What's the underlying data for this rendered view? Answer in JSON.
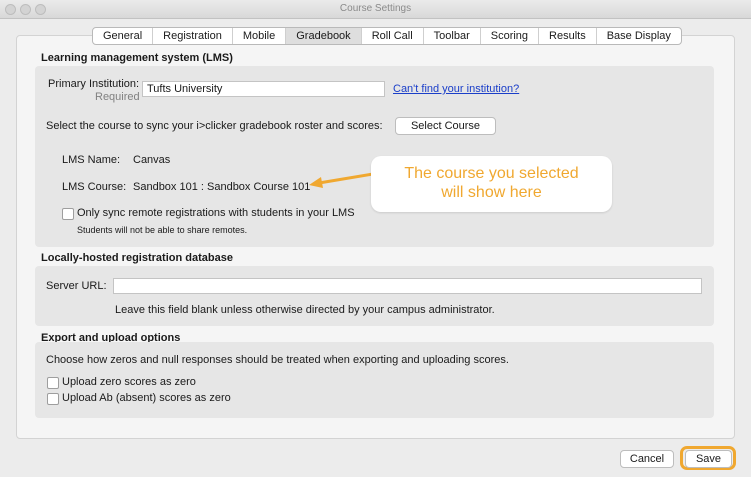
{
  "window": {
    "title": "Course Settings"
  },
  "tabs": [
    {
      "label": "General"
    },
    {
      "label": "Registration"
    },
    {
      "label": "Mobile"
    },
    {
      "label": "Gradebook",
      "active": true
    },
    {
      "label": "Roll Call"
    },
    {
      "label": "Toolbar"
    },
    {
      "label": "Scoring"
    },
    {
      "label": "Results"
    },
    {
      "label": "Base Display"
    }
  ],
  "lms": {
    "section_title": "Learning management system (LMS)",
    "institution_label": "Primary Institution:",
    "institution_required": "Required",
    "institution_value": "Tufts University",
    "cant_find_link": "Can't find your institution?",
    "select_course_prompt": "Select the course to sync your i>clicker gradebook roster and scores:",
    "select_course_button": "Select Course",
    "name_label": "LMS Name:",
    "name_value": "Canvas",
    "course_label": "LMS Course:",
    "course_value": "Sandbox 101 : Sandbox Course 101",
    "sync_checkbox_label": "Only sync remote registrations with students in your LMS",
    "sync_note": "Students will not be able to share remotes.",
    "sync_checked": false
  },
  "callout": {
    "line1": "The course you selected",
    "line2": "will show here"
  },
  "local_db": {
    "section_title": "Locally-hosted registration database",
    "server_label": "Server URL:",
    "server_value": "",
    "hint": "Leave this field blank unless otherwise directed by your campus administrator."
  },
  "export": {
    "section_title": "Export and upload options",
    "prompt": "Choose how zeros and null responses should be treated when exporting and uploading scores.",
    "zero_label": "Upload zero scores as zero",
    "absent_label": "Upload Ab (absent) scores as zero",
    "zero_checked": false,
    "absent_checked": false
  },
  "footer": {
    "cancel_label": "Cancel",
    "save_label": "Save"
  },
  "colors": {
    "accent": "#f0a830",
    "link": "#1a3ec9"
  }
}
